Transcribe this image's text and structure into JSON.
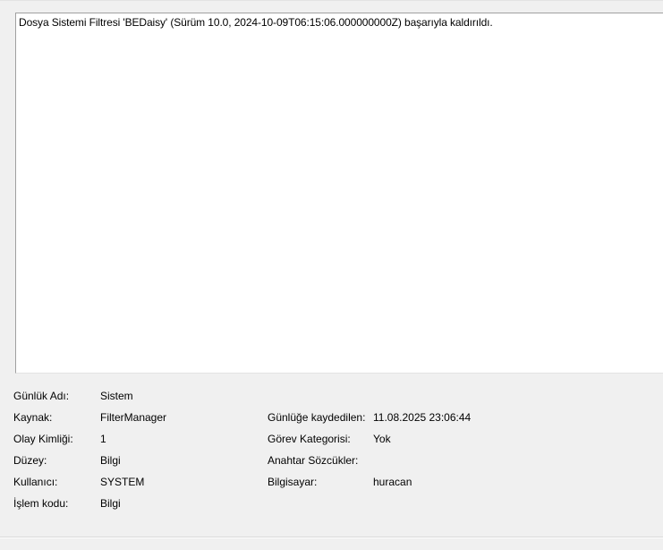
{
  "description": {
    "text": "Dosya Sistemi Filtresi 'BEDaisy' (Sürüm 10.0, 2024-10-09T06:15:06.000000000Z) başarıyla kaldırıldı."
  },
  "details": {
    "log_name": {
      "label": "Günlük Adı:",
      "value": "Sistem"
    },
    "source": {
      "label": "Kaynak:",
      "value": "FilterManager"
    },
    "logged": {
      "label": "Günlüğe kaydedilen:",
      "value": "11.08.2025 23:06:44"
    },
    "event_id": {
      "label": "Olay Kimliği:",
      "value": "1"
    },
    "task_category": {
      "label": "Görev Kategorisi:",
      "value": "Yok"
    },
    "level": {
      "label": "Düzey:",
      "value": "Bilgi"
    },
    "keywords": {
      "label": "Anahtar Sözcükler:",
      "value": ""
    },
    "user": {
      "label": "Kullanıcı:",
      "value": "SYSTEM"
    },
    "computer": {
      "label": "Bilgisayar:",
      "value": "huracan"
    },
    "opcode": {
      "label": "İşlem kodu:",
      "value": "Bilgi"
    }
  }
}
